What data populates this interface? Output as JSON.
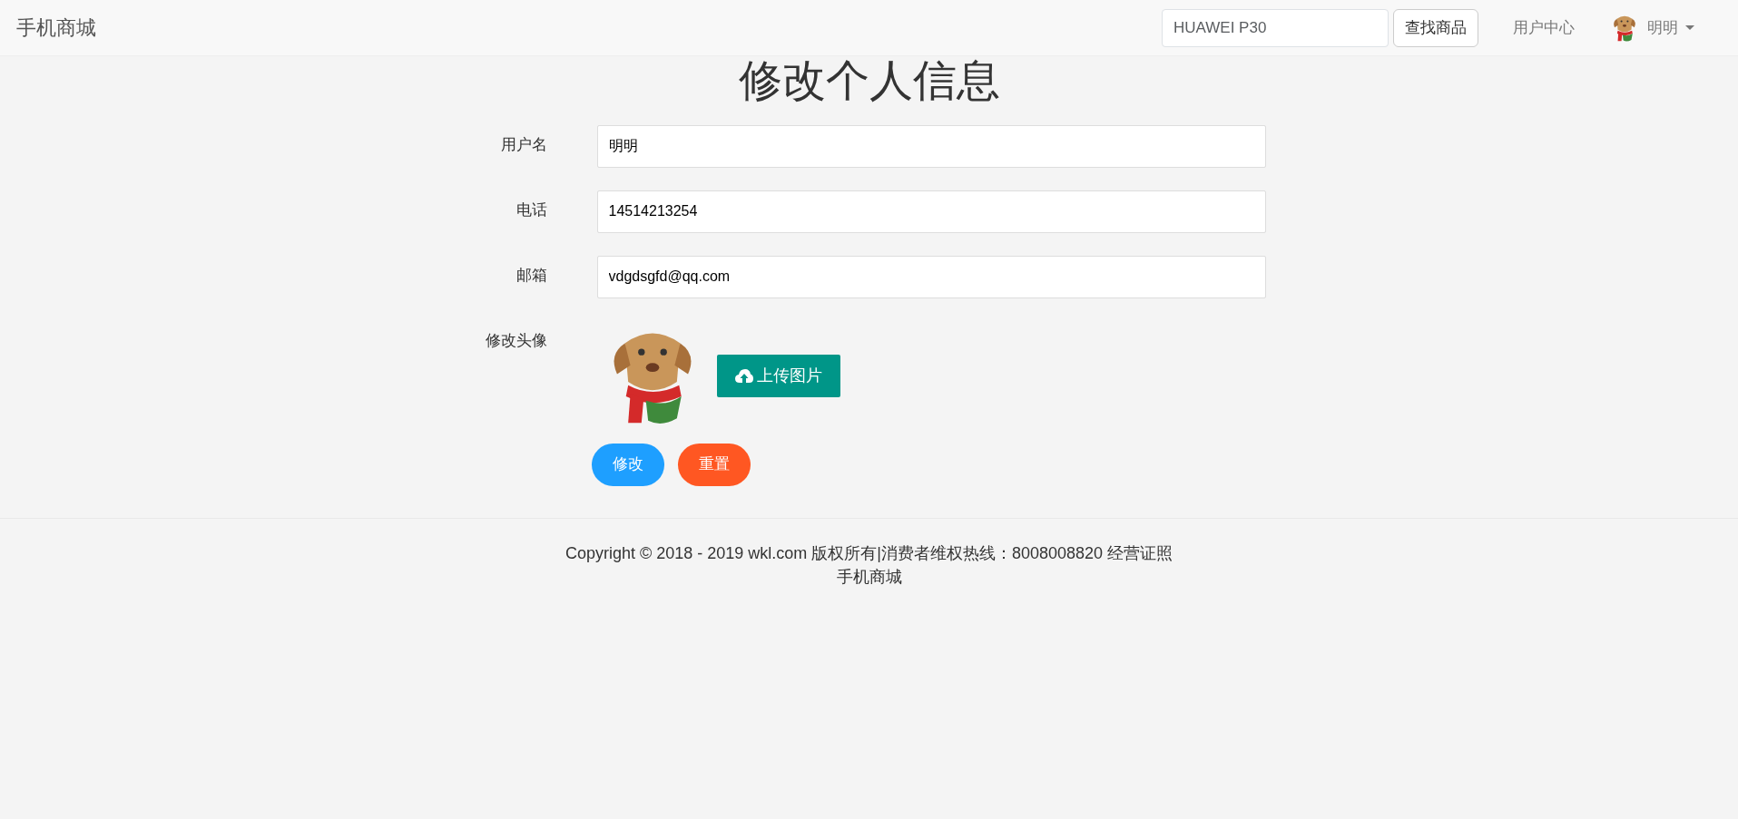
{
  "navbar": {
    "brand": "手机商城",
    "search": {
      "placeholder": "HUAWEI P30"
    },
    "search_button": "查找商品",
    "links": [
      "用户中心"
    ],
    "user": {
      "name": "明明"
    }
  },
  "title": "修改个人信息",
  "fields": [
    {
      "label": "用户名",
      "value": "明明"
    },
    {
      "label": "电话",
      "value": "14514213254"
    },
    {
      "label": "邮箱",
      "value": "vdgdsgfd@qq.com"
    }
  ],
  "avatar": {
    "label": "修改头像",
    "upload_button": "上传图片"
  },
  "buttons": [
    {
      "label": "修改",
      "kind": "submit"
    },
    {
      "label": "重置",
      "kind": "reset"
    }
  ],
  "footer": [
    "Copyright © 2018 - 2019 wkl.com 版权所有|消费者维权热线：8008008820 经营证照",
    "手机商城"
  ]
}
